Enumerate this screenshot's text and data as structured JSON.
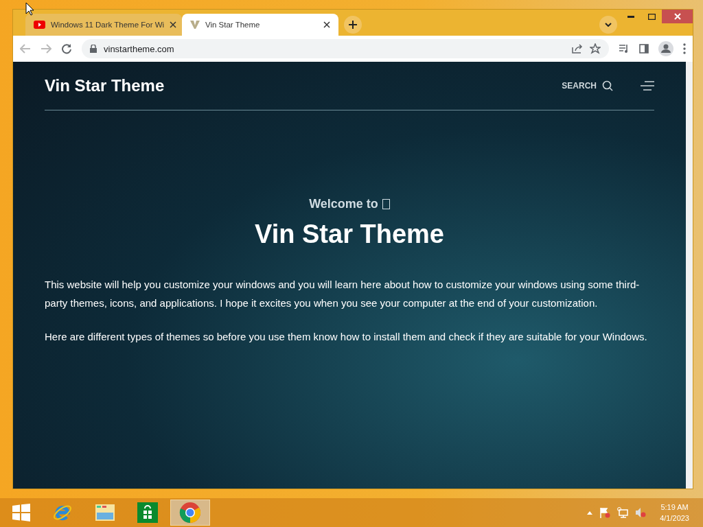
{
  "browser": {
    "tabs": [
      {
        "title": "Windows 11 Dark Theme For Wi",
        "kind": "video",
        "selected": false
      },
      {
        "title": "Vin Star Theme",
        "kind": "v-logo",
        "selected": true
      }
    ],
    "address": "vinstartheme.com"
  },
  "site": {
    "brand": "Vin Star Theme",
    "search_label": "SEARCH",
    "welcome": "Welcome to",
    "hero_title": "Vin Star Theme",
    "paragraphs": [
      "This website will help you customize your windows and you will learn here about how to customize your windows using some third-party themes, icons, and applications. I hope it excites you when you see your computer at the end of your customization.",
      "Here are different types of themes so before you use them know how to install them and check if they are suitable for your Windows."
    ]
  },
  "taskbar": {
    "apps": [
      {
        "kind": "ie",
        "selected": false
      },
      {
        "kind": "explorer",
        "selected": false
      },
      {
        "kind": "store",
        "selected": false
      },
      {
        "kind": "chrome",
        "selected": true
      }
    ],
    "time": "5:19 AM",
    "date": "4/1/2023"
  }
}
